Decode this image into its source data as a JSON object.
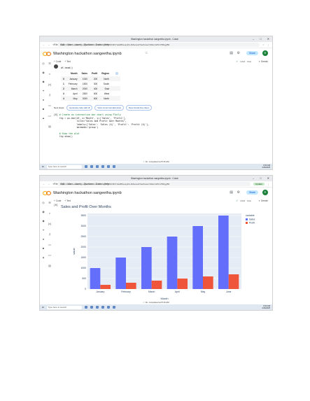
{
  "browser": {
    "tab_title": "Washington hackathon sangeetha.ipynb - Colab",
    "url1": "https://colab.research.google.com/drive/1bDDkgW53NhrRhYwkd8bxosyZA-4Mwuvs4?authuser=0#scrollTo=P9KgyBK",
    "url2": "https://colab.research.google.com/drive/1bDDkgW53NhrRhYwkd8bxosyZA-4Mwuvs4?authuser=0#scrollTo=P9KgyBK",
    "update_label": "Update"
  },
  "colab": {
    "notebook_title": "Washington hackathon sangeetha.ipynb",
    "menus": [
      "File",
      "Edit",
      "View",
      "Insert",
      "Runtime",
      "Tools",
      "Help"
    ],
    "share_label": "Share",
    "avatar_letter": "R",
    "add_code": "+ Code",
    "add_text": "+ Text",
    "ram": "RAM",
    "disk": "Disk",
    "gemini": "Gemini",
    "status_text": "completed at 8:16 AM",
    "status_time": "0s"
  },
  "cell1": {
    "prev_code": "df.head()",
    "table_headers": [
      "",
      "Month",
      "Sales",
      "Profit",
      "Region"
    ],
    "rows": [
      [
        "0",
        "January",
        "1000",
        "200",
        "North"
      ],
      [
        "1",
        "February",
        "1500",
        "300",
        "South"
      ],
      [
        "2",
        "March",
        "2000",
        "400",
        "East"
      ],
      [
        "3",
        "April",
        "2500",
        "500",
        "West"
      ],
      [
        "4",
        "May",
        "3000",
        "600",
        "North"
      ]
    ],
    "next_steps_label": "Next steps:",
    "chips": [
      "Generate code with df",
      "View recommended plots",
      "New interactive sheet"
    ]
  },
  "cell2": {
    "exec_count": "[6]",
    "lines": [
      "# Create an interactive bar chart using Plotly",
      "fig = px.bar(df, x='Month', y=['Sales', 'Profit'],",
      "             title=\"Sales and Profit Over Months\",",
      "             labels={'Sales': 'Sales ($)', 'Profit': 'Profit ($)'},",
      "             barmode='group')",
      "",
      "# Show the plot",
      "fig.show()"
    ]
  },
  "taskbar": {
    "search_placeholder": "Type here to search",
    "weather": "85°F",
    "time": "8:40 AM",
    "date": "2/16/2025",
    "lang": "ENG"
  },
  "colors": {
    "sales": "#636efa",
    "profit": "#ef553b",
    "plot_bg": "#e5ecf6"
  },
  "chart_data": {
    "type": "bar",
    "title": "Sales and Profit Over Months",
    "xlabel": "Month",
    "ylabel": "value",
    "categories": [
      "January",
      "February",
      "March",
      "April",
      "May",
      "June"
    ],
    "series": [
      {
        "name": "Sales",
        "values": [
          1000,
          1500,
          2000,
          2500,
          3000,
          3500
        ]
      },
      {
        "name": "Profit",
        "values": [
          200,
          300,
          400,
          500,
          600,
          700
        ]
      }
    ],
    "ylim": [
      0,
      3600
    ],
    "yticks": [
      0,
      500,
      1000,
      1500,
      2000,
      2500,
      3000,
      3500
    ],
    "legend_title": "variable",
    "legend_position": "right",
    "exec_count": "[6]"
  }
}
